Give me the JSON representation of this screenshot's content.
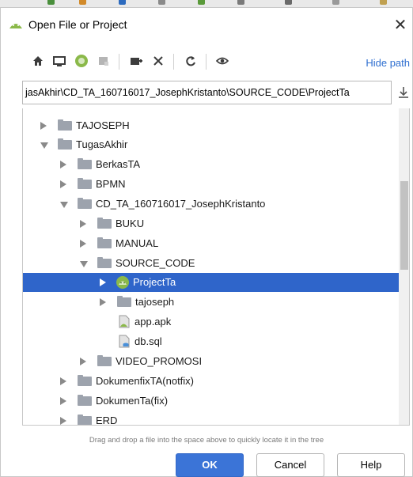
{
  "window": {
    "title": "Open File or Project",
    "close_glyph": "✕"
  },
  "toolbar": {
    "icons": [
      "home-icon",
      "desktop-icon",
      "project-icon",
      "module-icon",
      "new-folder-icon",
      "delete-icon",
      "refresh-icon",
      "show-hidden-icon"
    ],
    "hide_path_label": "Hide path"
  },
  "path": {
    "value": "jasAkhir\\CD_TA_160716017_JosephKristanto\\SOURCE_CODE\\ProjectTa"
  },
  "tree": {
    "items": [
      {
        "label": "TAJOSEPH",
        "type": "folder",
        "state": "collapsed"
      },
      {
        "label": "TugasAkhir",
        "type": "folder",
        "state": "expanded"
      },
      {
        "label": "BerkasTA",
        "type": "folder",
        "state": "collapsed"
      },
      {
        "label": "BPMN",
        "type": "folder",
        "state": "collapsed"
      },
      {
        "label": "CD_TA_160716017_JosephKristanto",
        "type": "folder",
        "state": "expanded"
      },
      {
        "label": "BUKU",
        "type": "folder",
        "state": "collapsed"
      },
      {
        "label": "MANUAL",
        "type": "folder",
        "state": "collapsed"
      },
      {
        "label": "SOURCE_CODE",
        "type": "folder",
        "state": "expanded"
      },
      {
        "label": "ProjectTa",
        "type": "project",
        "state": "collapsed",
        "selected": true
      },
      {
        "label": "tajoseph",
        "type": "folder",
        "state": "collapsed"
      },
      {
        "label": "app.apk",
        "type": "apk-file"
      },
      {
        "label": "db.sql",
        "type": "sql-file"
      },
      {
        "label": "VIDEO_PROMOSI",
        "type": "folder",
        "state": "collapsed"
      },
      {
        "label": "DokumenfixTA(notfix)",
        "type": "folder",
        "state": "collapsed"
      },
      {
        "label": "DokumenTa(fix)",
        "type": "folder",
        "state": "collapsed"
      },
      {
        "label": "ERD",
        "type": "folder",
        "state": "collapsed"
      }
    ]
  },
  "hint": "Drag and drop a file into the space above to quickly locate it in the tree",
  "buttons": {
    "ok": "OK",
    "cancel": "Cancel",
    "help": "Help"
  },
  "colors": {
    "selection": "#2f65ca",
    "accent": "#3b74d7",
    "link": "#2f6fd0",
    "android_green": "#8bb94a"
  }
}
